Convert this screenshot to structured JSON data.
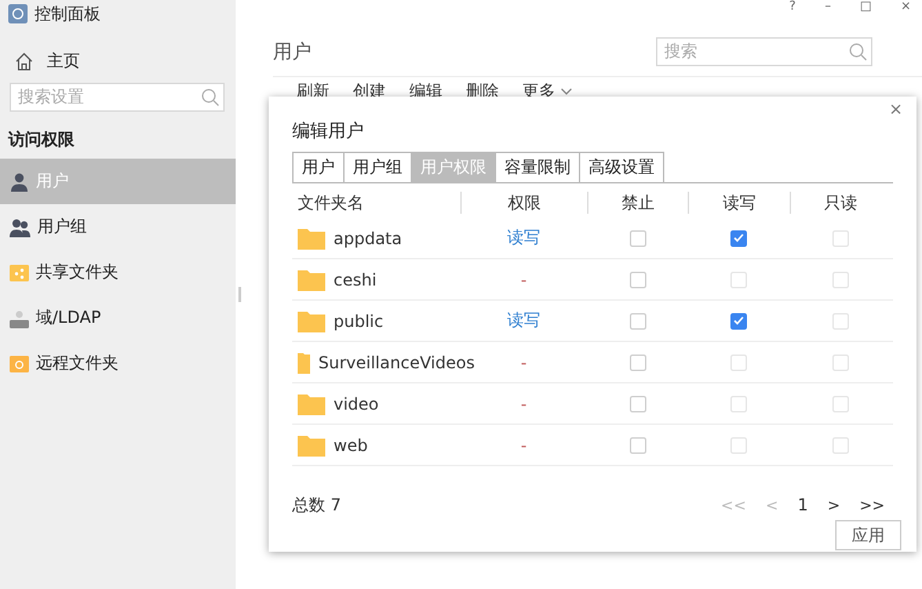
{
  "app": {
    "title": "控制面板",
    "home": "主页"
  },
  "sidebar": {
    "search": {
      "placeholder": "搜索设置"
    },
    "section": "访问权限",
    "items": [
      {
        "label": "用户",
        "kind": "user",
        "selected": true
      },
      {
        "label": "用户组",
        "kind": "group",
        "selected": false
      },
      {
        "label": "共享文件夹",
        "kind": "share",
        "selected": false
      },
      {
        "label": "域/LDAP",
        "kind": "ldap",
        "selected": false
      },
      {
        "label": "远程文件夹",
        "kind": "remote",
        "selected": false
      }
    ]
  },
  "window_controls": [
    "?",
    "–",
    "□",
    "×"
  ],
  "main": {
    "title": "用户",
    "search": {
      "placeholder": "搜索"
    },
    "toolbar": [
      "刷新",
      "创建",
      "编辑",
      "删除",
      "更多"
    ]
  },
  "dialog": {
    "title": "编辑用户",
    "close": "×",
    "tabs": [
      {
        "label": "用户",
        "selected": false
      },
      {
        "label": "用户组",
        "selected": false
      },
      {
        "label": "用户权限",
        "selected": true
      },
      {
        "label": "容量限制",
        "selected": false
      },
      {
        "label": "高级设置",
        "selected": false
      }
    ],
    "columns": [
      "文件夹名",
      "权限",
      "禁止",
      "读写",
      "只读"
    ],
    "rows": [
      {
        "name": "appdata",
        "permission": "读写",
        "permission_set": true,
        "deny": {
          "checked": false,
          "disabled": false
        },
        "read_write": {
          "checked": true,
          "disabled": false
        },
        "read_only": {
          "checked": false,
          "disabled": true
        }
      },
      {
        "name": "ceshi",
        "permission": "-",
        "permission_set": false,
        "deny": {
          "checked": false,
          "disabled": false
        },
        "read_write": {
          "checked": false,
          "disabled": true
        },
        "read_only": {
          "checked": false,
          "disabled": true
        }
      },
      {
        "name": "public",
        "permission": "读写",
        "permission_set": true,
        "deny": {
          "checked": false,
          "disabled": false
        },
        "read_write": {
          "checked": true,
          "disabled": false
        },
        "read_only": {
          "checked": false,
          "disabled": true
        }
      },
      {
        "name": "SurveillanceVideos",
        "permission": "-",
        "permission_set": false,
        "deny": {
          "checked": false,
          "disabled": false
        },
        "read_write": {
          "checked": false,
          "disabled": true
        },
        "read_only": {
          "checked": false,
          "disabled": true
        }
      },
      {
        "name": "video",
        "permission": "-",
        "permission_set": false,
        "deny": {
          "checked": false,
          "disabled": false
        },
        "read_write": {
          "checked": false,
          "disabled": true
        },
        "read_only": {
          "checked": false,
          "disabled": true
        }
      },
      {
        "name": "web",
        "permission": "-",
        "permission_set": false,
        "deny": {
          "checked": false,
          "disabled": false
        },
        "read_write": {
          "checked": false,
          "disabled": true
        },
        "read_only": {
          "checked": false,
          "disabled": true
        }
      }
    ],
    "total": "总数 7",
    "pagination": {
      "first": "<<",
      "prev": "<",
      "page": "1",
      "next": ">",
      "last": ">>"
    },
    "apply": "应用"
  }
}
